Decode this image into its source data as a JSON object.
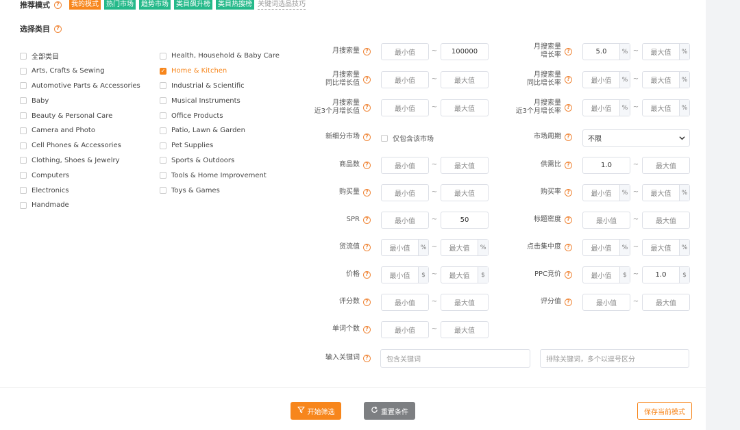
{
  "mode": {
    "label": "推荐模式",
    "tags": [
      {
        "label": "我的模式",
        "color": "#f7861c"
      },
      {
        "label": "热门市场",
        "color": "#25b98a"
      },
      {
        "label": "趋势市场",
        "color": "#25b98a"
      },
      {
        "label": "类目飙升榜",
        "color": "#25b98a"
      },
      {
        "label": "类目热搜榜",
        "color": "#25b98a"
      }
    ],
    "tips_link": "关键词选品技巧"
  },
  "category": {
    "label": "选择类目",
    "col1": [
      {
        "label": "全部类目",
        "checked": false
      },
      {
        "label": "Arts, Crafts & Sewing",
        "checked": false
      },
      {
        "label": "Automotive Parts & Accessories",
        "checked": false
      },
      {
        "label": "Baby",
        "checked": false
      },
      {
        "label": "Beauty & Personal Care",
        "checked": false
      },
      {
        "label": "Camera and Photo",
        "checked": false
      },
      {
        "label": "Cell Phones & Accessories",
        "checked": false
      },
      {
        "label": "Clothing, Shoes & Jewelry",
        "checked": false
      },
      {
        "label": "Computers",
        "checked": false
      },
      {
        "label": "Electronics",
        "checked": false
      },
      {
        "label": "Handmade",
        "checked": false
      }
    ],
    "col2": [
      {
        "label": "Health, Household & Baby Care",
        "checked": false
      },
      {
        "label": "Home & Kitchen",
        "checked": true
      },
      {
        "label": "Industrial & Scientific",
        "checked": false
      },
      {
        "label": "Musical Instruments",
        "checked": false
      },
      {
        "label": "Office Products",
        "checked": false
      },
      {
        "label": "Patio, Lawn & Garden",
        "checked": false
      },
      {
        "label": "Pet Supplies",
        "checked": false
      },
      {
        "label": "Sports & Outdoors",
        "checked": false
      },
      {
        "label": "Tools & Home Improvement",
        "checked": false
      },
      {
        "label": "Toys & Games",
        "checked": false
      }
    ]
  },
  "placeholders": {
    "min": "最小值",
    "max": "最大值"
  },
  "filters": {
    "monthly_search": {
      "label": "月搜索量",
      "max": "100000"
    },
    "monthly_growth": {
      "label1": "月搜索量",
      "label2": "增长率",
      "min": "5.0",
      "unit": "%"
    },
    "yoy_growth": {
      "label1": "月搜索量",
      "label2": "同比增长值"
    },
    "yoy_growth_rate": {
      "label1": "月搜索量",
      "label2": "同比增长率",
      "unit": "%"
    },
    "three_month_growth": {
      "label1": "月搜索量",
      "label2": "近3个月增长值"
    },
    "three_month_growth_rate": {
      "label1": "月搜索量",
      "label2": "近3个月增长率",
      "unit": "%"
    },
    "sub_market": {
      "label": "新细分市场",
      "checkbox_label": "仅包含该市场"
    },
    "market_cycle": {
      "label": "市场周期",
      "value": "不限"
    },
    "product_count": {
      "label": "商品数"
    },
    "supply_demand": {
      "label": "供需比",
      "min": "1.0"
    },
    "purchases": {
      "label": "购买量"
    },
    "purchase_rate": {
      "label": "购买率",
      "unit": "%"
    },
    "spr": {
      "label": "SPR",
      "max": "50"
    },
    "title_density": {
      "label": "标题密度"
    },
    "goods_value": {
      "label": "货流值",
      "unit": "%"
    },
    "click_concentration": {
      "label": "点击集中度",
      "unit": "%"
    },
    "price": {
      "label": "价格",
      "unit": "$"
    },
    "ppc_bid": {
      "label": "PPC竞价",
      "max": "1.0",
      "unit": "$"
    },
    "rating_count": {
      "label": "评分数"
    },
    "rating_value": {
      "label": "评分值"
    },
    "word_count": {
      "label": "单词个数"
    },
    "keyword": {
      "label": "输入关键词",
      "include_placeholder": "包含关键词",
      "exclude_placeholder": "排除关键词，多个以逗号区分"
    }
  },
  "actions": {
    "start": "开始筛选",
    "reset": "重置条件",
    "save": "保存当前模式"
  }
}
